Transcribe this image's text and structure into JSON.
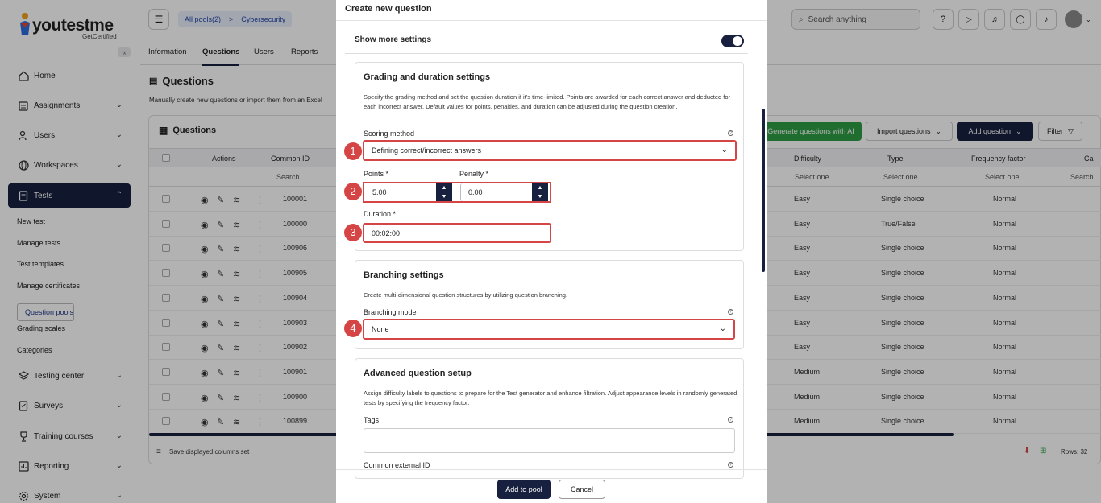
{
  "brand": {
    "name": "youtestme",
    "tagline": "GetCertified"
  },
  "sidebar": {
    "items": [
      {
        "label": "Home"
      },
      {
        "label": "Assignments"
      },
      {
        "label": "Users"
      },
      {
        "label": "Workspaces"
      },
      {
        "label": "Tests"
      },
      {
        "label": "Testing center"
      },
      {
        "label": "Surveys"
      },
      {
        "label": "Training courses"
      },
      {
        "label": "Reporting"
      },
      {
        "label": "System"
      }
    ],
    "tests_sub": [
      "New test",
      "Manage tests",
      "Test templates",
      "Manage certificates",
      "Question pools",
      "Grading scales",
      "Categories"
    ]
  },
  "header": {
    "breadcrumb": [
      "All pools(2)",
      ">",
      "Cybersecurity"
    ],
    "search_placeholder": "Search anything"
  },
  "tabs": [
    "Information",
    "Questions",
    "Users",
    "Reports"
  ],
  "page": {
    "title": "Questions",
    "description": "Manually create new questions or import them from an Excel",
    "panel_title": "Questions",
    "buttons": {
      "generate": "Generate questions with AI",
      "import": "Import questions",
      "add": "Add question",
      "filter": "Filter"
    }
  },
  "table": {
    "columns": {
      "actions": "Actions",
      "common_id": "Common ID",
      "difficulty": "Difficulty",
      "type": "Type",
      "frequency": "Frequency factor",
      "ca": "Ca"
    },
    "filters": {
      "search": "Search",
      "select_one": "Select one"
    },
    "rows": [
      {
        "id": "100001",
        "difficulty": "Easy",
        "type": "Single choice",
        "freq": "Normal"
      },
      {
        "id": "100000",
        "difficulty": "Easy",
        "type": "True/False",
        "freq": "Normal"
      },
      {
        "id": "100906",
        "difficulty": "Easy",
        "type": "Single choice",
        "freq": "Normal"
      },
      {
        "id": "100905",
        "difficulty": "Easy",
        "type": "Single choice",
        "freq": "Normal"
      },
      {
        "id": "100904",
        "difficulty": "Easy",
        "type": "Single choice",
        "freq": "Normal"
      },
      {
        "id": "100903",
        "difficulty": "Easy",
        "type": "Single choice",
        "freq": "Normal"
      },
      {
        "id": "100902",
        "difficulty": "Easy",
        "type": "Single choice",
        "freq": "Normal"
      },
      {
        "id": "100901",
        "difficulty": "Medium",
        "type": "Single choice",
        "freq": "Normal"
      },
      {
        "id": "100900",
        "difficulty": "Medium",
        "type": "Single choice",
        "freq": "Normal"
      },
      {
        "id": "100899",
        "difficulty": "Medium",
        "type": "Single choice",
        "freq": "Normal"
      }
    ],
    "footer": {
      "save_columns": "Save displayed columns set",
      "rows": "Rows: 32"
    }
  },
  "modal": {
    "title": "Create new question",
    "show_more": "Show more settings",
    "grading": {
      "title": "Grading and duration settings",
      "description": "Specify the grading method and set the question duration if it's time-limited. Points are awarded for each correct answer and deducted for each incorrect answer. Default values for points, penalties, and duration can be adjusted during the question creation.",
      "scoring_label": "Scoring method",
      "scoring_value": "Defining correct/incorrect answers",
      "points_label": "Points *",
      "points_value": "5.00",
      "penalty_label": "Penalty *",
      "penalty_value": "0.00",
      "duration_label": "Duration *",
      "duration_value": "00:02:00"
    },
    "branching": {
      "title": "Branching settings",
      "description": "Create multi-dimensional question structures by utilizing question branching.",
      "mode_label": "Branching mode",
      "mode_value": "None"
    },
    "advanced": {
      "title": "Advanced question setup",
      "description": "Assign difficulty labels to questions to prepare for the Test generator and enhance filtration. Adjust appearance levels in randomly generated tests by specifying the frequency factor.",
      "tags_label": "Tags",
      "external_id_label": "Common external ID"
    },
    "markers": [
      "1",
      "2",
      "3",
      "4"
    ],
    "footer": {
      "add": "Add to pool",
      "cancel": "Cancel"
    }
  },
  "colors": {
    "navy": "#17203f",
    "highlight": "#d64545",
    "green": "#2f9e44"
  }
}
